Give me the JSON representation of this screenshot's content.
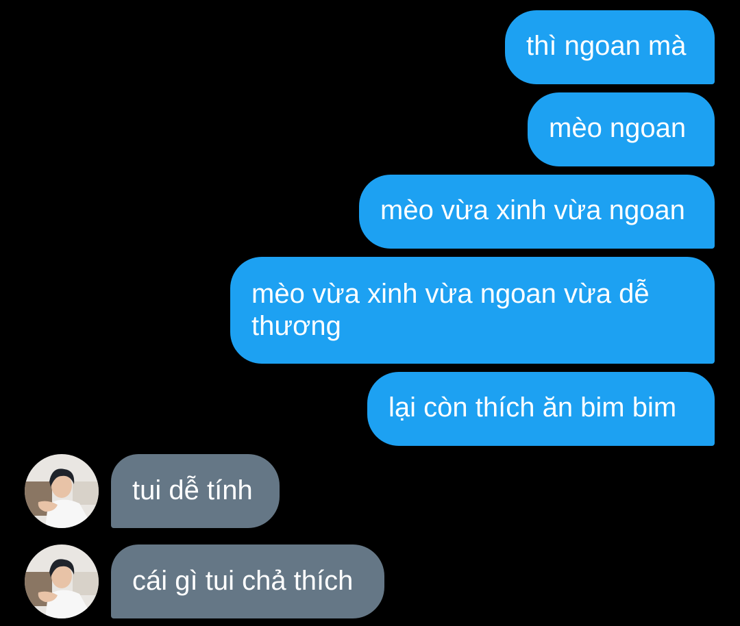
{
  "messages": [
    {
      "direction": "outgoing",
      "text": "thì ngoan mà"
    },
    {
      "direction": "outgoing",
      "text": "mèo ngoan"
    },
    {
      "direction": "outgoing",
      "text": "mèo vừa xinh vừa ngoan"
    },
    {
      "direction": "outgoing",
      "text": "mèo vừa xinh vừa ngoan vừa dễ\nthương"
    },
    {
      "direction": "outgoing",
      "text": "lại còn thích ăn bim bim"
    },
    {
      "direction": "incoming",
      "text": "tui dễ tính"
    },
    {
      "direction": "incoming",
      "text": "cái gì tui chả thích"
    }
  ],
  "colors": {
    "background": "#000000",
    "outgoing_bubble": "#1da1f2",
    "incoming_bubble": "#657786",
    "text": "#ffffff"
  },
  "icons": {
    "avatar": "user-avatar-photo"
  }
}
